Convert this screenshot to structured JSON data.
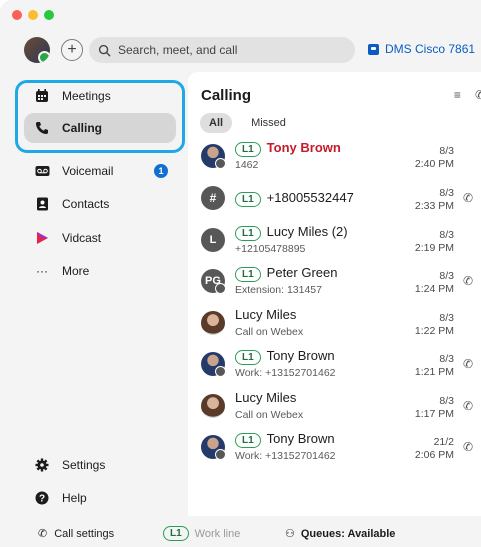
{
  "topbar": {
    "search_placeholder": "Search, meet, and call",
    "device_label": "DMS Cisco 7861"
  },
  "sidebar": {
    "items": [
      {
        "label": "Meetings",
        "icon": "calendar-icon"
      },
      {
        "label": "Calling",
        "icon": "phone-icon",
        "active": true
      },
      {
        "label": "Voicemail",
        "icon": "voicemail-icon",
        "badge": "1"
      },
      {
        "label": "Contacts",
        "icon": "contacts-icon"
      },
      {
        "label": "Vidcast",
        "icon": "vidcast-icon"
      },
      {
        "label": "More",
        "icon": "more-icon"
      }
    ],
    "bottom": [
      {
        "label": "Settings",
        "icon": "gear-icon"
      },
      {
        "label": "Help",
        "icon": "help-icon"
      }
    ]
  },
  "panel": {
    "title": "Calling",
    "filters": [
      "All",
      "Missed"
    ],
    "line_tag": "L1",
    "calls": [
      {
        "name": "Tony Brown",
        "sub": "1462",
        "date": "8/3",
        "time": "2:40 PM",
        "missed": true,
        "has_line": true,
        "avatar": "photo-m",
        "callback": false
      },
      {
        "name": "+18005532447",
        "sub": "",
        "date": "8/3",
        "time": "2:33 PM",
        "missed": false,
        "has_line": true,
        "avatar": "#",
        "callback": true
      },
      {
        "name": "Lucy Miles (2)",
        "sub": "+12105478895",
        "date": "8/3",
        "time": "2:19 PM",
        "missed": false,
        "has_line": true,
        "avatar": "L",
        "callback": false
      },
      {
        "name": "Peter Green",
        "sub": "Extension: 131457",
        "date": "8/3",
        "time": "1:24 PM",
        "missed": false,
        "has_line": true,
        "avatar": "PG",
        "callback": true
      },
      {
        "name": "Lucy Miles",
        "sub": "Call on Webex",
        "date": "8/3",
        "time": "1:22 PM",
        "missed": false,
        "has_line": false,
        "avatar": "photo-f",
        "callback": false
      },
      {
        "name": "Tony Brown",
        "sub": "Work: +13152701462",
        "date": "8/3",
        "time": "1:21 PM",
        "missed": false,
        "has_line": true,
        "avatar": "photo-m",
        "callback": true
      },
      {
        "name": "Lucy Miles",
        "sub": "Call on Webex",
        "date": "8/3",
        "time": "1:17 PM",
        "missed": false,
        "has_line": false,
        "avatar": "photo-f",
        "callback": true
      },
      {
        "name": "Tony Brown",
        "sub": "Work: +13152701462",
        "date": "21/2",
        "time": "2:06 PM",
        "missed": false,
        "has_line": true,
        "avatar": "photo-m",
        "callback": true
      }
    ]
  },
  "footer": {
    "call_settings": "Call settings",
    "line_tag": "L1",
    "line_label": "Work line",
    "queues": "Queues: Available"
  },
  "colors": {
    "accent": "#0a5dc2",
    "highlight": "#1ca9e6",
    "missed": "#c41a2a",
    "line_tag": "#2a9d58"
  }
}
